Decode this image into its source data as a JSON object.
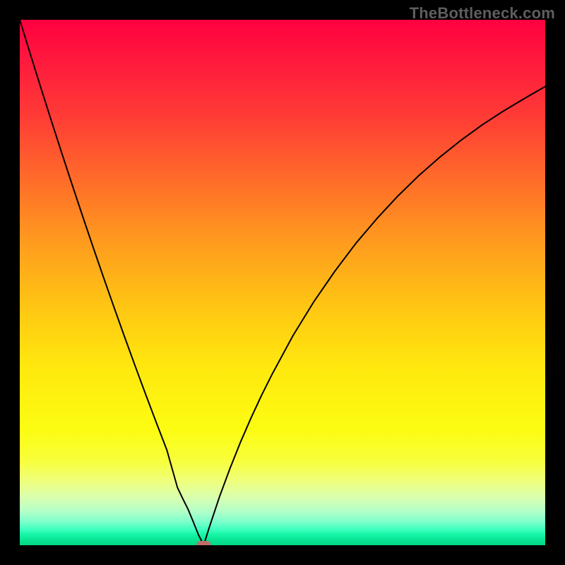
{
  "watermark": "TheBottleneck.com",
  "colors": {
    "frame": "#000000",
    "curve": "#000000",
    "marker": "#bd6f6a",
    "gradient_top": "#ff0040",
    "gradient_mid": "#ffe80e",
    "gradient_bottom": "#04d684"
  },
  "chart_data": {
    "type": "line",
    "title": "",
    "xlabel": "",
    "ylabel": "",
    "xlim": [
      0,
      100
    ],
    "ylim": [
      0,
      100
    ],
    "grid": false,
    "legend": false,
    "series": [
      {
        "name": "bottleneck-curve",
        "x": [
          0,
          2,
          4,
          6,
          8,
          10,
          12,
          14,
          16,
          18,
          20,
          22,
          24,
          26,
          28,
          30,
          31,
          32,
          33,
          34,
          35,
          36,
          38,
          40,
          42,
          44,
          46,
          48,
          52,
          56,
          60,
          64,
          68,
          72,
          76,
          80,
          84,
          88,
          92,
          96,
          100
        ],
        "y": [
          100,
          93.5,
          87.1,
          80.8,
          74.6,
          68.5,
          62.5,
          56.6,
          50.8,
          45.1,
          39.5,
          34.0,
          28.6,
          23.3,
          18.1,
          11.0,
          8.9,
          6.9,
          4.5,
          2.0,
          0.0,
          3.2,
          9.2,
          14.6,
          19.6,
          24.2,
          28.5,
          32.5,
          39.9,
          46.4,
          52.2,
          57.5,
          62.2,
          66.5,
          70.4,
          73.9,
          77.1,
          80.0,
          82.6,
          85.0,
          87.3
        ]
      }
    ],
    "annotations": [
      {
        "name": "optimum-marker",
        "x": 35,
        "y": 0,
        "shape": "pill"
      }
    ]
  }
}
